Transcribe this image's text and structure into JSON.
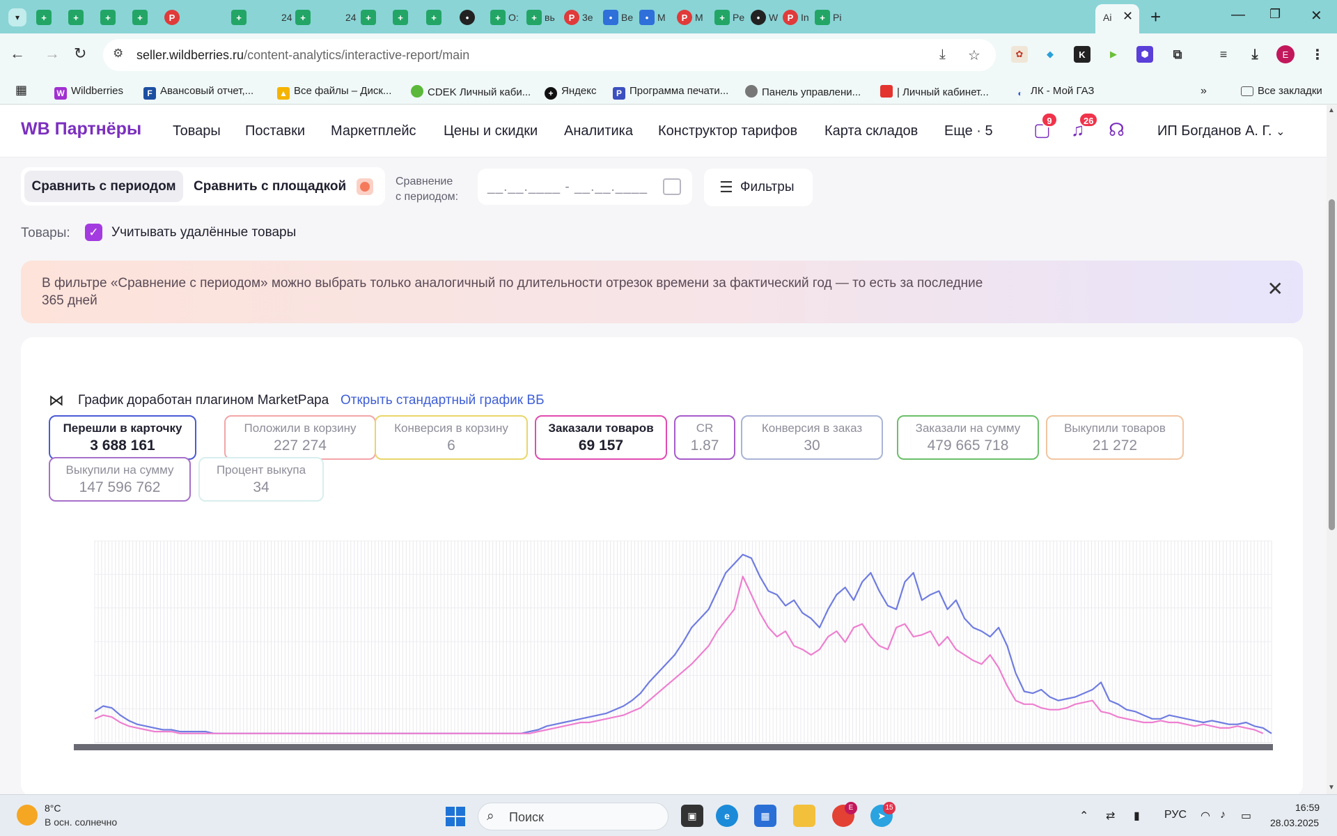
{
  "browser": {
    "tabs": [
      {
        "label": ""
      },
      {
        "label": ""
      },
      {
        "label": ""
      },
      {
        "label": ""
      },
      {
        "label": ""
      },
      {
        "label": ""
      },
      {
        "label": ""
      },
      {
        "label": "24"
      },
      {
        "label": ""
      },
      {
        "label": "24"
      },
      {
        "label": ""
      },
      {
        "label": ""
      },
      {
        "label": ""
      },
      {
        "label": ""
      },
      {
        "label": "O:"
      },
      {
        "label": "вь"
      },
      {
        "label": "3e"
      },
      {
        "label": "Be"
      },
      {
        "label": "M"
      },
      {
        "label": "M"
      },
      {
        "label": "Pe"
      },
      {
        "label": "W"
      },
      {
        "label": "In"
      },
      {
        "label": "Pi"
      },
      {
        "label": "Aі"
      }
    ],
    "url_host": "seller.wildberries.ru",
    "url_path": "/content-analytics/interactive-report/main",
    "bookmarks": [
      {
        "label": "Wildberries"
      },
      {
        "label": "Авансовый отчет,..."
      },
      {
        "label": "Все файлы – Диск..."
      },
      {
        "label": "CDEK Личный каби..."
      },
      {
        "label": "Яндекс"
      },
      {
        "label": "Программа печати..."
      },
      {
        "label": "Панель управлени..."
      },
      {
        "label": "| Личный кабинет..."
      },
      {
        "label": "ЛК - Мой ГАЗ"
      }
    ],
    "all_bookmarks_label": "Все закладки",
    "profile_initial": "E"
  },
  "header": {
    "logo": "WB Партнёры",
    "nav": [
      "Товары",
      "Поставки",
      "Маркетплейс",
      "Цены и скидки",
      "Аналитика",
      "Конструктор тарифов",
      "Карта складов",
      "Еще · 5"
    ],
    "messages_badge": "9",
    "notifications_badge": "26",
    "account": "ИП Богданов А. Г."
  },
  "filters": {
    "compare_period": "Сравнить с периодом",
    "compare_platform": "Сравнить с площадкой",
    "compare_label_line1": "Сравнение",
    "compare_label_line2": "с периодом:",
    "date_placeholder": "__.__.____ - __.__.____",
    "filters_button": "Фильтры",
    "goods_label": "Товары:",
    "include_deleted": "Учитывать удалённые товары"
  },
  "banner": {
    "text": "В фильтре «Сравнение с периодом» можно выбрать только аналогичный по длительности отрезок времени за фактический год — то есть за последние 365 дней"
  },
  "plugin": {
    "text": "График доработан плагином MarketPapa",
    "link": "Открыть стандартный график ВБ"
  },
  "metrics": [
    {
      "label": "Перешли в карточку",
      "value": "3 688 161",
      "color": "#4a5ad6",
      "active": true
    },
    {
      "label": "Положили в корзину",
      "value": "227 274",
      "color": "#f2a5a8",
      "active": false
    },
    {
      "label": "Конверсия в корзину",
      "value": "6",
      "color": "#e9d66a",
      "active": false
    },
    {
      "label": "Заказали товаров",
      "value": "69 157",
      "color": "#e14bb0",
      "active": true
    },
    {
      "label": "CR",
      "value": "1.87",
      "color": "#a65cc9",
      "active": false
    },
    {
      "label": "Конверсия в заказ",
      "value": "30",
      "color": "#a9b4d6",
      "active": false
    },
    {
      "label": "Заказали на сумму",
      "value": "479 665 718",
      "color": "#6cbf6a",
      "active": false
    },
    {
      "label": "Выкупили товаров",
      "value": "21 272",
      "color": "#f2c5a2",
      "active": false
    },
    {
      "label": "Выкупили на сумму",
      "value": "147 596 762",
      "color": "#a66fc9",
      "active": false
    },
    {
      "label": "Процент выкупа",
      "value": "34",
      "color": "#d8eeee",
      "active": false
    }
  ],
  "chart_data": {
    "type": "line",
    "series": [
      {
        "color": "#6f7ce0",
        "values": [
          14,
          17,
          16,
          12,
          9,
          7,
          6,
          5,
          4,
          4,
          3,
          3,
          3,
          3,
          2,
          2,
          2,
          2,
          2,
          2,
          2,
          2,
          2,
          2,
          2,
          2,
          2,
          2,
          2,
          2,
          2,
          2,
          2,
          2,
          2,
          2,
          2,
          2,
          2,
          2,
          2,
          2,
          2,
          2,
          2,
          2,
          2,
          2,
          2,
          2,
          2,
          3,
          4,
          6,
          7,
          8,
          9,
          10,
          11,
          12,
          13,
          15,
          17,
          20,
          24,
          30,
          35,
          40,
          45,
          52,
          60,
          65,
          70,
          80,
          90,
          95,
          100,
          98,
          88,
          80,
          78,
          72,
          75,
          68,
          65,
          60,
          70,
          78,
          82,
          75,
          85,
          90,
          80,
          72,
          70,
          85,
          90,
          75,
          78,
          80,
          70,
          75,
          65,
          60,
          58,
          55,
          60,
          50,
          35,
          25,
          24,
          26,
          22,
          20,
          21,
          22,
          24,
          26,
          30,
          20,
          18,
          15,
          14,
          12,
          10,
          10,
          12,
          11,
          10,
          9,
          8,
          9,
          8,
          7,
          7,
          8,
          6,
          5,
          2
        ]
      },
      {
        "color": "#ee7fcf",
        "values": [
          10,
          12,
          11,
          8,
          6,
          5,
          4,
          3,
          3,
          3,
          2,
          2,
          2,
          2,
          2,
          2,
          2,
          2,
          2,
          2,
          2,
          2,
          2,
          2,
          2,
          2,
          2,
          2,
          2,
          2,
          2,
          2,
          2,
          2,
          2,
          2,
          2,
          2,
          2,
          2,
          2,
          2,
          2,
          2,
          2,
          2,
          2,
          2,
          2,
          2,
          2,
          2,
          3,
          4,
          5,
          6,
          7,
          8,
          8,
          9,
          10,
          11,
          12,
          14,
          16,
          20,
          24,
          28,
          32,
          36,
          40,
          45,
          50,
          58,
          64,
          70,
          88,
          78,
          68,
          60,
          55,
          58,
          50,
          48,
          45,
          48,
          55,
          58,
          52,
          60,
          62,
          55,
          50,
          48,
          60,
          62,
          55,
          56,
          58,
          50,
          55,
          48,
          45,
          42,
          40,
          45,
          38,
          28,
          20,
          18,
          18,
          16,
          15,
          15,
          16,
          18,
          19,
          20,
          14,
          13,
          11,
          10,
          9,
          8,
          8,
          9,
          8,
          8,
          7,
          6,
          7,
          6,
          5,
          5,
          6,
          5,
          4,
          2
        ]
      }
    ],
    "grid": true,
    "ylim": [
      0,
      100
    ]
  },
  "taskbar": {
    "temperature": "8°C",
    "weather": "В осн. солнечно",
    "search": "Поиск",
    "telegram_badge": "15",
    "chrome_badge": "E",
    "lang": "РУС",
    "time": "16:59",
    "date": "28.03.2025"
  }
}
